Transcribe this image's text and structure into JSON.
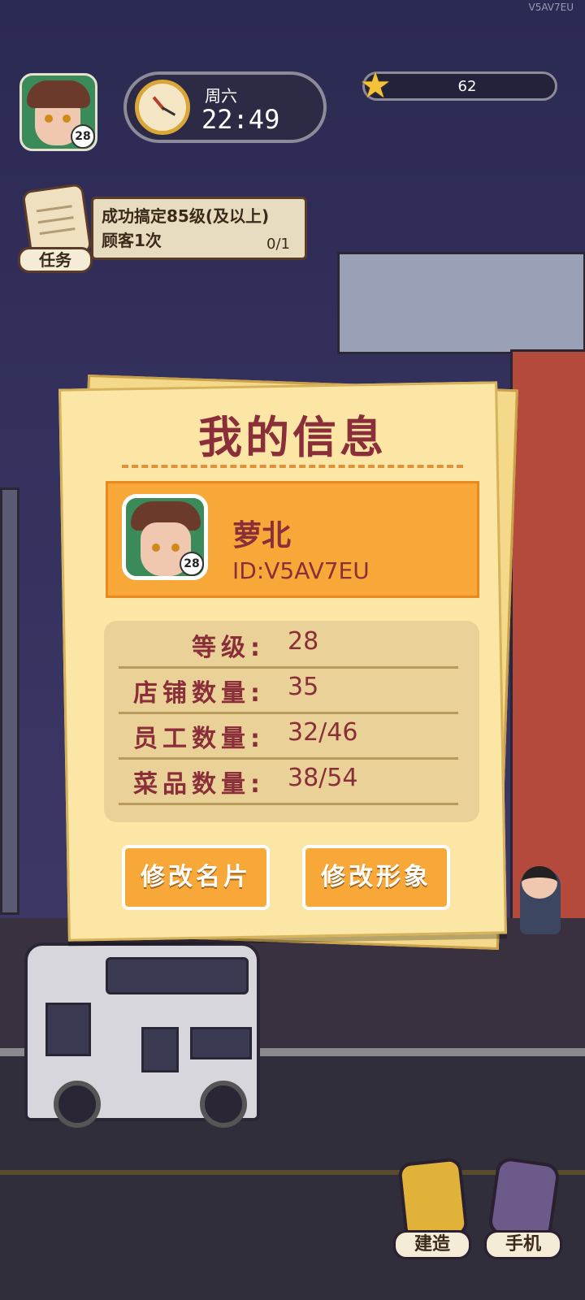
{
  "watermark": "V5AV7EU",
  "hud": {
    "avatar_level": "28",
    "day": "周六",
    "time": "22:49",
    "stars": "62"
  },
  "task": {
    "label": "任务",
    "text": "成功搞定85级(及以上)顾客1次",
    "progress": "0/1"
  },
  "info_card": {
    "title": "我的信息",
    "player": {
      "name": "萝北",
      "id": "ID:V5AV7EU",
      "level_badge": "28"
    },
    "stats": [
      {
        "label": "等级:",
        "value": "28"
      },
      {
        "label": "店铺数量:",
        "value": "35"
      },
      {
        "label": "员工数量:",
        "value": "32/46"
      },
      {
        "label": "菜品数量:",
        "value": "38/54"
      }
    ],
    "buttons": {
      "edit_card": "修改名片",
      "edit_look": "修改形象"
    }
  },
  "bottom_nav": {
    "build": "建造",
    "phone": "手机"
  }
}
